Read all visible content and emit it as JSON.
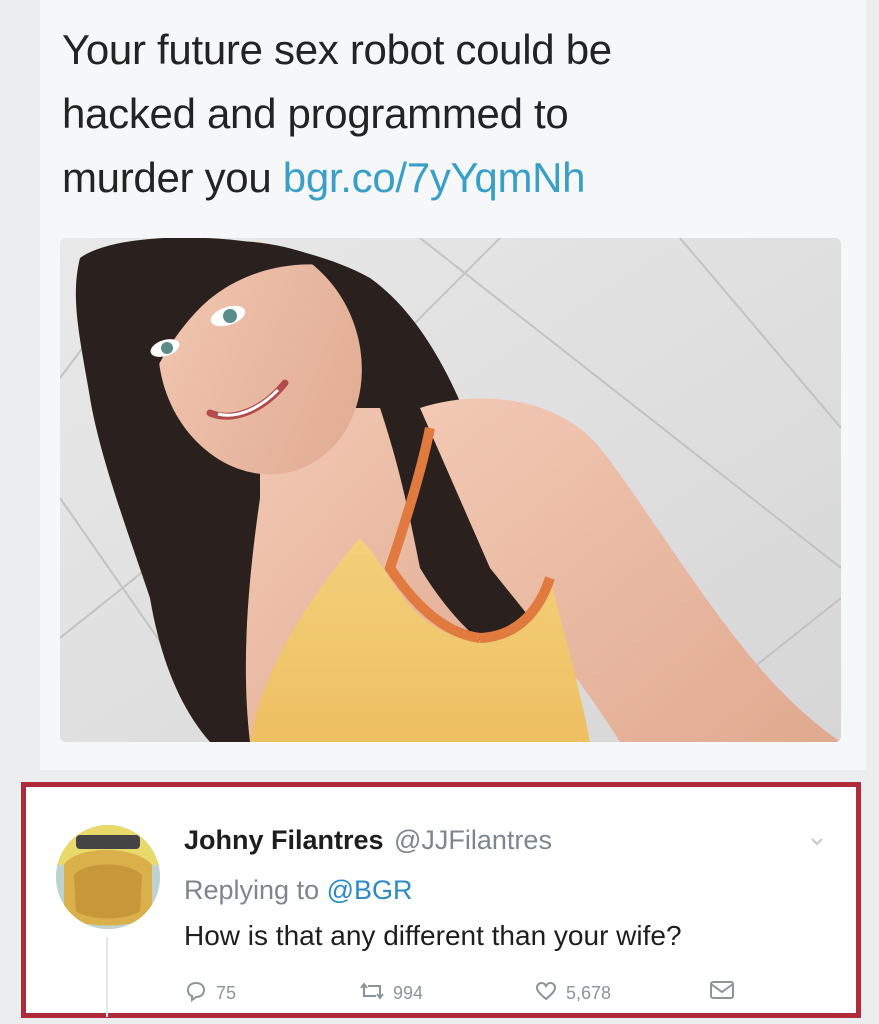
{
  "tweet": {
    "text_line1": "Your future sex robot could be",
    "text_line2": "hacked and programmed to",
    "text_line3_prefix": "murder you",
    "link": "bgr.co/7yYqmNh"
  },
  "media": {
    "description_icon": "photo-image"
  },
  "reply": {
    "author_name": "Johny Filantres",
    "author_handle": "@JJFilantres",
    "replying_prefix": "Replying to",
    "replying_to": "@BGR",
    "text": "How is that any different than your wife?",
    "counts": {
      "replies": "75",
      "retweets": "994",
      "likes": "5,678"
    }
  },
  "colors": {
    "highlight_border": "#b12a3c",
    "link": "#3a9fc7",
    "mention": "#2c8bc4",
    "muted": "#7d868f"
  },
  "icons": [
    "reply-icon",
    "retweet-icon",
    "like-icon",
    "message-icon",
    "chevron-down-icon"
  ]
}
